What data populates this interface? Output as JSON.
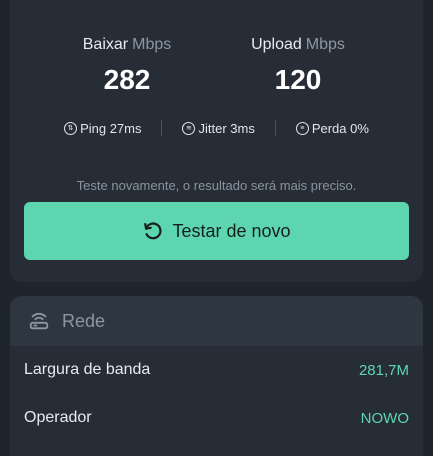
{
  "results": {
    "download": {
      "label": "Baixar",
      "unit": "Mbps",
      "value": "282"
    },
    "upload": {
      "label": "Upload",
      "unit": "Mbps",
      "value": "120"
    },
    "stats": {
      "ping": "Ping 27ms",
      "jitter": "Jitter 3ms",
      "loss": "Perda 0%"
    },
    "retest_hint": "Teste novamente, o resultado será mais preciso.",
    "retest_button": "Testar de novo"
  },
  "network": {
    "title": "Rede",
    "rows": [
      {
        "label": "Largura de banda",
        "value": "281,7M"
      },
      {
        "label": "Operador",
        "value": "NOWO"
      }
    ]
  },
  "colors": {
    "accent": "#5dd6b0",
    "background": "#1f252d",
    "card": "#262d36"
  }
}
